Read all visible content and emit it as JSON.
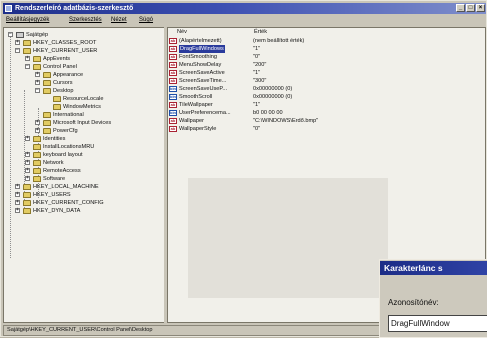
{
  "window": {
    "title": "Rendszerleíró adatbázis-szerkesztő",
    "buttons": {
      "minimize": "_",
      "maximize": "□",
      "close": "×"
    }
  },
  "menu": [
    "Beállításjegyzék",
    "Szerkesztés",
    "Nézet",
    "Súgó"
  ],
  "tree": {
    "root": "Sajátgép",
    "nodes": [
      {
        "label": "HKEY_CLASSES_ROOT",
        "expander": "+"
      },
      {
        "label": "HKEY_CURRENT_USER",
        "expander": "−"
      },
      {
        "label": "AppEvents",
        "expander": "+"
      },
      {
        "label": "Control Panel",
        "expander": "−"
      },
      {
        "label": "Appearance",
        "expander": "+"
      },
      {
        "label": "Cursors",
        "expander": "+"
      },
      {
        "label": "Desktop",
        "expander": "−"
      },
      {
        "label": "ResourceLocale",
        "expander": ""
      },
      {
        "label": "WindowMetrics",
        "expander": ""
      },
      {
        "label": "International",
        "expander": ""
      },
      {
        "label": "Microsoft Input Devices",
        "expander": "+"
      },
      {
        "label": "PowerCfg",
        "expander": "+"
      },
      {
        "label": "Identities",
        "expander": "+"
      },
      {
        "label": "InstallLocationsMRU",
        "expander": ""
      },
      {
        "label": "keyboard layout",
        "expander": "+"
      },
      {
        "label": "Network",
        "expander": "+"
      },
      {
        "label": "RemoteAccess",
        "expander": "+"
      },
      {
        "label": "Software",
        "expander": "+"
      },
      {
        "label": "HKEY_LOCAL_MACHINE",
        "expander": "+"
      },
      {
        "label": "HKEY_USERS",
        "expander": "+"
      },
      {
        "label": "HKEY_CURRENT_CONFIG",
        "expander": "+"
      },
      {
        "label": "HKEY_DYN_DATA",
        "expander": "+"
      }
    ]
  },
  "list": {
    "columns": {
      "name": "Név",
      "value": "Érték"
    },
    "rows": [
      {
        "type_icon": "ab",
        "name": "(Alapértelmezett)",
        "value": "(nem beállított érték)"
      },
      {
        "type_icon": "ab",
        "name": "DragFullWindows",
        "value": "\"1\"",
        "selected": true
      },
      {
        "type_icon": "ab",
        "name": "FontSmoothing",
        "value": "\"0\""
      },
      {
        "type_icon": "ab",
        "name": "MenuShowDelay",
        "value": "\"200\""
      },
      {
        "type_icon": "ab",
        "name": "ScreenSaveActive",
        "value": "\"1\""
      },
      {
        "type_icon": "ab",
        "name": "ScreenSaveTime...",
        "value": "\"300\""
      },
      {
        "type_icon": "bin",
        "name": "ScreenSaveUseP...",
        "value": "0x00000000 (0)"
      },
      {
        "type_icon": "bin",
        "name": "SmoothScroll",
        "value": "0x00000000 (0)"
      },
      {
        "type_icon": "ab",
        "name": "TileWallpaper",
        "value": "\"1\""
      },
      {
        "type_icon": "bin",
        "name": "UserPreferencema...",
        "value": "b0 00 00 00"
      },
      {
        "type_icon": "ab",
        "name": "Wallpaper",
        "value": "\"C:\\WINDOWS\\Erdő.bmp\""
      },
      {
        "type_icon": "ab",
        "name": "WallpaperStyle",
        "value": "\"0\""
      }
    ]
  },
  "status_bar": "Sajátgép\\HKEY_CURRENT_USER\\Control Panel\\Desktop",
  "dialog": {
    "title": "Karakterlánc s",
    "name_label": "Azonosítónév:",
    "name_value": "DragFullWindow"
  },
  "colors": {
    "title_bar": "#1e2f8a",
    "selection": "#2a3b9c"
  }
}
